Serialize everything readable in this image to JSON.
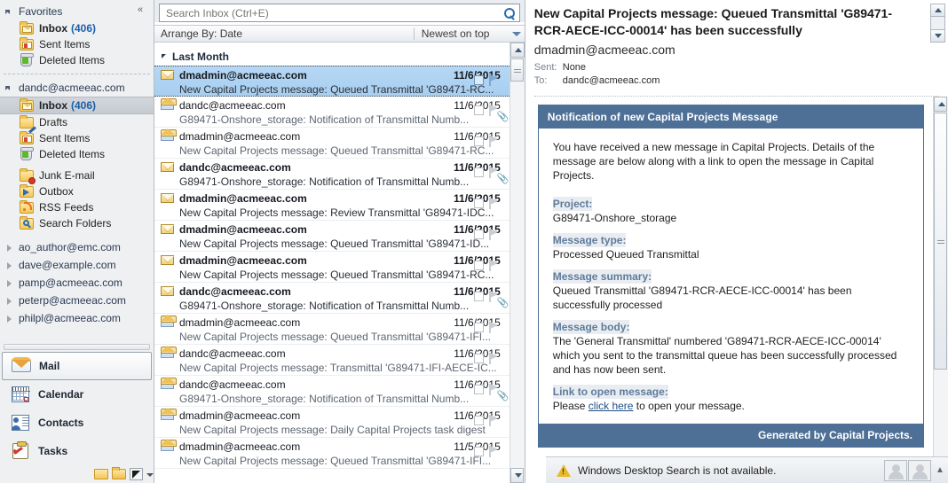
{
  "navpane": {
    "favorites": {
      "label": "Favorites",
      "collapse_icon": "chevron-left-icon",
      "items": [
        {
          "label": "Inbox",
          "count": "(406)",
          "icon": "folder-inbox-icon",
          "bold": true
        },
        {
          "label": "Sent Items",
          "count": "",
          "icon": "folder-sent-icon",
          "bold": false
        },
        {
          "label": "Deleted Items",
          "count": "",
          "icon": "folder-deleted-icon",
          "bold": false
        }
      ]
    },
    "account": {
      "label": "dandc@acmeeac.com",
      "items": [
        {
          "label": "Inbox",
          "count": "(406)",
          "icon": "folder-inbox-icon",
          "bold": true,
          "selected": true
        },
        {
          "label": "Drafts",
          "count": "",
          "icon": "folder-drafts-icon",
          "bold": false,
          "selected": false
        },
        {
          "label": "Sent Items",
          "count": "",
          "icon": "folder-sent-icon",
          "bold": false,
          "selected": false
        },
        {
          "label": "Deleted Items",
          "count": "",
          "icon": "folder-deleted-icon",
          "bold": false,
          "selected": false
        },
        {
          "label": "Junk E-mail",
          "count": "",
          "icon": "folder-junk-icon",
          "bold": false,
          "selected": false,
          "gap": true
        },
        {
          "label": "Outbox",
          "count": "",
          "icon": "folder-outbox-icon",
          "bold": false,
          "selected": false
        },
        {
          "label": "RSS Feeds",
          "count": "",
          "icon": "folder-rss-icon",
          "bold": false,
          "selected": false
        },
        {
          "label": "Search Folders",
          "count": "",
          "icon": "folder-search-icon",
          "bold": false,
          "selected": false
        }
      ]
    },
    "other_accounts": [
      {
        "label": "ao_author@emc.com"
      },
      {
        "label": "dave@example.com"
      },
      {
        "label": "pamp@acmeeac.com"
      },
      {
        "label": "peterp@acmeeac.com"
      },
      {
        "label": "philpl@acmeeac.com"
      }
    ],
    "modules": [
      {
        "label": "Mail",
        "icon": "mail-icon",
        "selected": true
      },
      {
        "label": "Calendar",
        "icon": "calendar-icon",
        "selected": false
      },
      {
        "label": "Contacts",
        "icon": "contacts-icon",
        "selected": false
      },
      {
        "label": "Tasks",
        "icon": "tasks-icon",
        "selected": false
      }
    ],
    "footer_buttons": [
      {
        "icon": "notes-folder-icon"
      },
      {
        "icon": "folder-list-icon"
      },
      {
        "icon": "shortcuts-icon"
      },
      {
        "icon": "configure-buttons-caret-icon"
      }
    ]
  },
  "list": {
    "search": {
      "placeholder": "Search Inbox (Ctrl+E)",
      "value": "",
      "icon": "search-icon"
    },
    "arrange": {
      "left_label": "Arrange By: Date",
      "right_label": "Newest on top",
      "caret_icon": "chevron-down-icon"
    },
    "group_header": "Last Month",
    "rows": [
      {
        "from": "dmadmin@acmeeac.com",
        "date": "11/6/2015",
        "subject": "New Capital Projects message: Queued Transmittal 'G89471-RC...",
        "unread": true,
        "selected": true,
        "attachment": false
      },
      {
        "from": "dandc@acmeeac.com",
        "date": "11/6/2015",
        "subject": "G89471-Onshore_storage: Notification of Transmittal Numb...",
        "unread": false,
        "selected": false,
        "attachment": true
      },
      {
        "from": "dmadmin@acmeeac.com",
        "date": "11/6/2015",
        "subject": "New Capital Projects message: Queued Transmittal 'G89471-RC...",
        "unread": false,
        "selected": false,
        "attachment": false
      },
      {
        "from": "dandc@acmeeac.com",
        "date": "11/6/2015",
        "subject": "G89471-Onshore_storage: Notification of Transmittal Numb...",
        "unread": true,
        "selected": false,
        "attachment": true
      },
      {
        "from": "dmadmin@acmeeac.com",
        "date": "11/6/2015",
        "subject": "New Capital Projects message: Review Transmittal 'G89471-IDC...",
        "unread": true,
        "selected": false,
        "attachment": false
      },
      {
        "from": "dmadmin@acmeeac.com",
        "date": "11/6/2015",
        "subject": "New Capital Projects message: Queued Transmittal 'G89471-ID...",
        "unread": true,
        "selected": false,
        "attachment": false
      },
      {
        "from": "dmadmin@acmeeac.com",
        "date": "11/6/2015",
        "subject": "New Capital Projects message: Queued Transmittal 'G89471-RC...",
        "unread": true,
        "selected": false,
        "attachment": false
      },
      {
        "from": "dandc@acmeeac.com",
        "date": "11/6/2015",
        "subject": "G89471-Onshore_storage: Notification of Transmittal Numb...",
        "unread": true,
        "selected": false,
        "attachment": true
      },
      {
        "from": "dmadmin@acmeeac.com",
        "date": "11/6/2015",
        "subject": "New Capital Projects message: Queued Transmittal 'G89471-IFI...",
        "unread": false,
        "selected": false,
        "attachment": false
      },
      {
        "from": "dandc@acmeeac.com",
        "date": "11/6/2015",
        "subject": "New Capital Projects message: Transmittal 'G89471-IFI-AECE-IC...",
        "unread": false,
        "selected": false,
        "attachment": false
      },
      {
        "from": "dandc@acmeeac.com",
        "date": "11/6/2015",
        "subject": "G89471-Onshore_storage: Notification of Transmittal Numb...",
        "unread": false,
        "selected": false,
        "attachment": true
      },
      {
        "from": "dmadmin@acmeeac.com",
        "date": "11/6/2015",
        "subject": "New Capital Projects message: Daily Capital Projects task digest",
        "unread": false,
        "selected": false,
        "attachment": false
      },
      {
        "from": "dmadmin@acmeeac.com",
        "date": "11/5/2015",
        "subject": "New Capital Projects message: Queued Transmittal 'G89471-IFI...",
        "unread": false,
        "selected": false,
        "attachment": false
      }
    ]
  },
  "reading": {
    "subject": "New Capital Projects message: Queued Transmittal 'G89471-RCR-AECE-ICC-00014' has been successfully",
    "sender": "dmadmin@acmeeac.com",
    "sent_label": "Sent:",
    "sent_value": "None",
    "to_label": "To:",
    "to_value": "dandc@acmeeac.com",
    "card": {
      "header": "Notification of new Capital Projects Message",
      "intro": "You have received a new message in Capital Projects. Details of the message are below along with a link to open the message in Capital Projects.",
      "fields": [
        {
          "label": "Project:",
          "value": "G89471-Onshore_storage"
        },
        {
          "label": "Message type:",
          "value": "Processed Queued Transmittal"
        },
        {
          "label": "Message summary:",
          "value": "Queued Transmittal 'G89471-RCR-AECE-ICC-00014' has been successfully processed"
        },
        {
          "label": "Message body:",
          "value": "The 'General Transmittal' numbered 'G89471-RCR-AECE-ICC-00014' which you sent to the transmittal queue has been successfully processed and has now been sent."
        }
      ],
      "link_label": "Link to open message:",
      "link_prefix": "Please ",
      "link_text": "click here",
      "link_suffix": " to open your message.",
      "footer": "Generated by Capital Projects."
    }
  },
  "statusbar": {
    "warning_icon": "warning-icon",
    "text": "Windows Desktop Search is not available.",
    "buttons": [
      {
        "icon": "person-icon"
      },
      {
        "icon": "person-icon"
      }
    ],
    "caret_icon": "chevron-up-icon"
  },
  "colors": {
    "accent": "#4f7096",
    "selection": "#b6d7f4",
    "link": "#1e4f86",
    "count": "#1d5fa8"
  }
}
